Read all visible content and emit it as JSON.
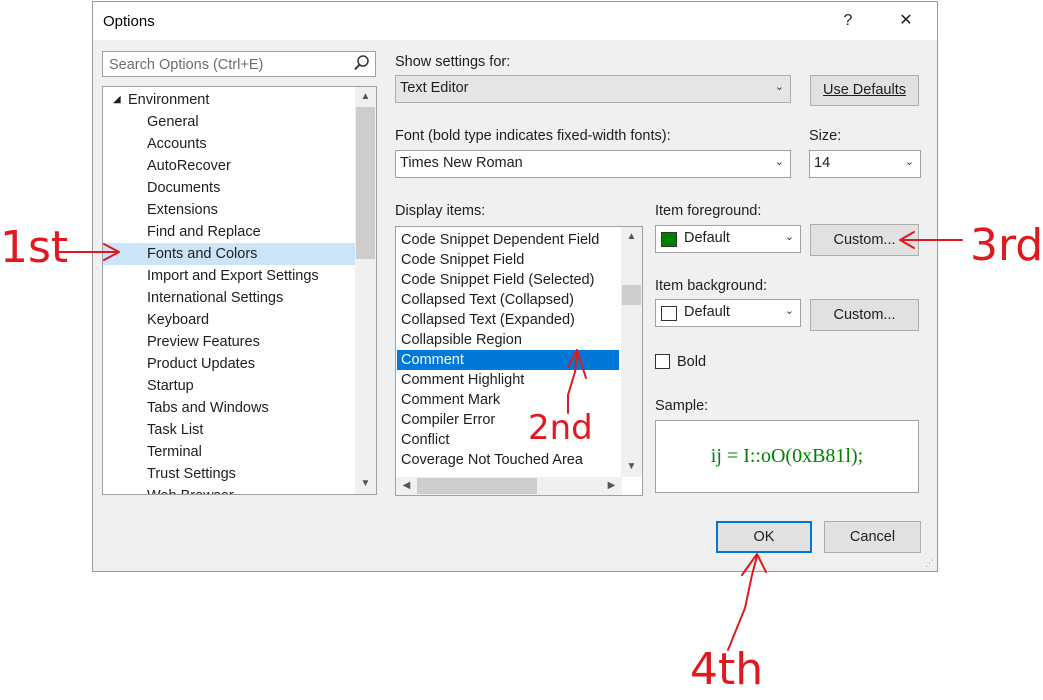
{
  "dialog": {
    "title": "Options",
    "help_label": "?",
    "close_label": "✕"
  },
  "search": {
    "placeholder": "Search Options (Ctrl+E)"
  },
  "tree": {
    "root": "Environment",
    "items": [
      "General",
      "Accounts",
      "AutoRecover",
      "Documents",
      "Extensions",
      "Find and Replace",
      "Fonts and Colors",
      "Import and Export Settings",
      "International Settings",
      "Keyboard",
      "Preview Features",
      "Product Updates",
      "Startup",
      "Tabs and Windows",
      "Task List",
      "Terminal",
      "Trust Settings",
      "Web Browser"
    ],
    "selected_index": 6
  },
  "show_settings": {
    "label": "Show settings for:",
    "value": "Text Editor"
  },
  "use_defaults": {
    "label": "Use Defaults"
  },
  "font": {
    "label": "Font (bold type indicates fixed-width fonts):",
    "value": "Times New Roman"
  },
  "size": {
    "label": "Size:",
    "value": "14"
  },
  "display_items": {
    "label": "Display items:",
    "items": [
      "Code Snippet Dependent Field",
      "Code Snippet Field",
      "Code Snippet Field (Selected)",
      "Collapsed Text (Collapsed)",
      "Collapsed Text (Expanded)",
      "Collapsible Region",
      "Comment",
      "Comment Highlight",
      "Comment Mark",
      "Compiler Error",
      "Conflict",
      "Coverage Not Touched Area"
    ],
    "selected_index": 6
  },
  "foreground": {
    "label": "Item foreground:",
    "value": "Default",
    "swatch_color": "#008000",
    "custom_label": "Custom..."
  },
  "background": {
    "label": "Item background:",
    "value": "Default",
    "swatch_color": "#ffffff",
    "custom_label": "Custom..."
  },
  "bold": {
    "label": "Bold",
    "checked": false
  },
  "sample": {
    "label": "Sample:",
    "text": "ij = I::oO(0xB81l);",
    "color": "#008000"
  },
  "buttons": {
    "ok": "OK",
    "cancel": "Cancel"
  },
  "annotations": {
    "first": "1st",
    "second": "2nd",
    "third": "3rd",
    "fourth": "4th",
    "color": "#e0191f"
  }
}
